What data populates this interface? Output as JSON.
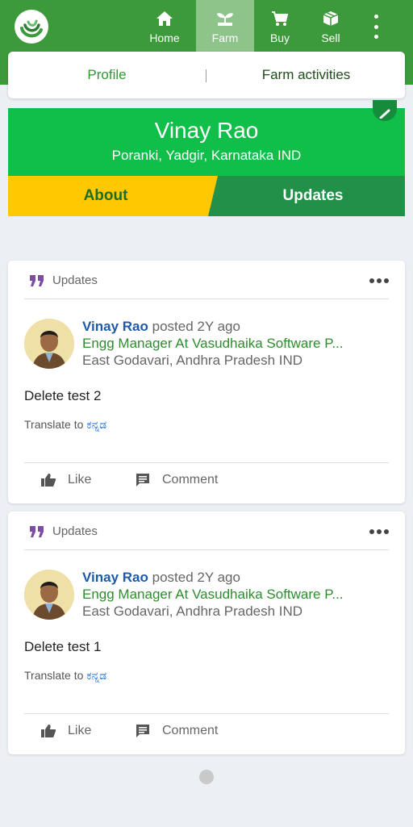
{
  "nav": {
    "items": [
      {
        "label": "Home",
        "icon": "home-icon"
      },
      {
        "label": "Farm",
        "icon": "sprout-icon",
        "active": true
      },
      {
        "label": "Buy",
        "icon": "cart-icon"
      },
      {
        "label": "Sell",
        "icon": "box-icon"
      }
    ]
  },
  "tabs": {
    "profile": "Profile",
    "farm_activities": "Farm activities"
  },
  "profile": {
    "name": "Vinay Rao",
    "location": "Poranki, Yadgir, Karnataka IND"
  },
  "subtabs": {
    "about": "About",
    "updates": "Updates"
  },
  "posts": [
    {
      "type": "Updates",
      "author": "Vinay Rao",
      "posted": "posted 2Y ago",
      "role": "Engg Manager At Vasudhaika Software P...",
      "location": "East Godavari, Andhra Pradesh IND",
      "text": "Delete test 2",
      "translate_label": "Translate to",
      "translate_lang": "ಕನ್ನಡ",
      "like": "Like",
      "comment": "Comment"
    },
    {
      "type": "Updates",
      "author": "Vinay Rao",
      "posted": "posted 2Y ago",
      "role": "Engg Manager At Vasudhaika Software P...",
      "location": "East Godavari, Andhra Pradesh IND",
      "text": "Delete test 1",
      "translate_label": "Translate to",
      "translate_lang": "ಕನ್ನಡ",
      "like": "Like",
      "comment": "Comment"
    }
  ],
  "colors": {
    "nav_green": "#3c9a3a",
    "banner_green": "#0fbf4a",
    "about_yellow": "#ffc800",
    "updates_green": "#21914a",
    "link_blue": "#1f5aa8"
  }
}
